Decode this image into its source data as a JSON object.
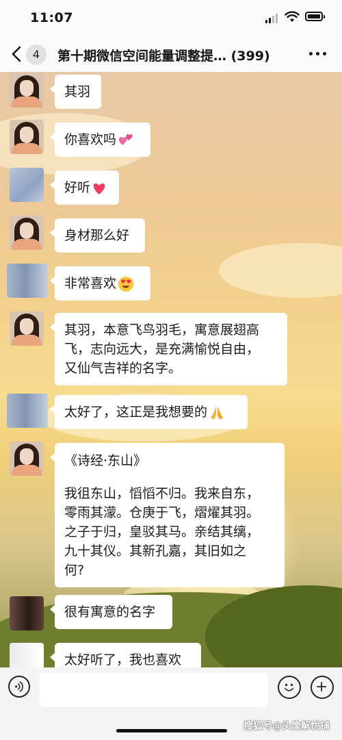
{
  "status_bar": {
    "time": "11:07"
  },
  "header": {
    "unread_count": "4",
    "title": "第十期微信空间能量调整提… (399)"
  },
  "messages": [
    {
      "avatar": "woman-photo",
      "lines": [
        "其羽"
      ]
    },
    {
      "avatar": "woman-photo",
      "lines": [
        "你喜欢吗"
      ],
      "emoji": "two-hearts"
    },
    {
      "avatar": "blurred",
      "lines": [
        "好听"
      ],
      "emoji": "red-heart"
    },
    {
      "avatar": "woman-photo",
      "lines": [
        "身材那么好"
      ]
    },
    {
      "avatar": "blurred",
      "lines": [
        "非常喜欢"
      ],
      "emoji": "heart-eyes"
    },
    {
      "avatar": "woman-photo",
      "lines": [
        "其羽，本意飞鸟羽毛，寓意展翅高",
        "飞，志向远大，是充满愉悦自由，",
        "又仙气吉祥的名字。"
      ]
    },
    {
      "avatar": "blurred",
      "lines": [
        "太好了，这正是我想要的"
      ],
      "emoji": "folded-hands"
    },
    {
      "avatar": "woman-photo",
      "lines": [
        "《诗经·东山》",
        "",
        "我徂东山，慆慆不归。我来自东，",
        "零雨其濛。仓庚于飞，熠燿其羽。",
        "之子于归，皇驳其马。亲结其缡，",
        "九十其仪。其新孔嘉，其旧如之",
        "何?"
      ]
    },
    {
      "avatar": "blurred",
      "lines": [
        "很有寓意的名字"
      ]
    },
    {
      "avatar": "blurred",
      "lines": [
        "太好听了，我也喜欢"
      ]
    }
  ],
  "watermark": "搜狐号@头像解忧铺",
  "icons": {
    "back": "chevron-left-icon",
    "more": "ellipsis-icon",
    "voice": "voice-icon",
    "emoji": "smiley-icon",
    "plus": "plus-icon"
  },
  "colors": {
    "bubble": "#ffffff",
    "text": "#1b1b1b"
  }
}
